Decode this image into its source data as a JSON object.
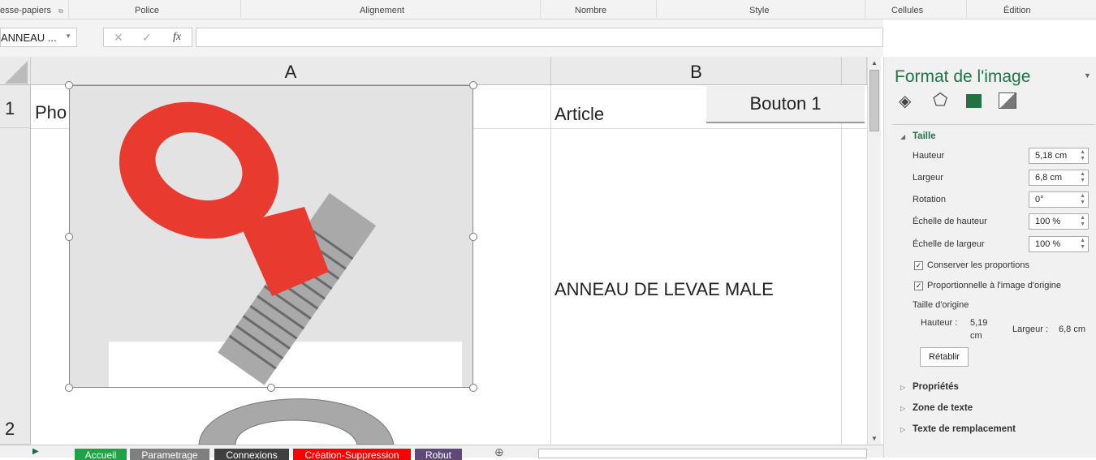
{
  "ribbon": {
    "groups": [
      "esse-papiers",
      "Police",
      "Alignement",
      "Nombre",
      "Style",
      "Cellules",
      "Édition"
    ]
  },
  "formula_bar": {
    "name_box": "ANNEAU ...",
    "cancel": "✕",
    "enter": "✓",
    "fx": "fx",
    "value": ""
  },
  "sheet": {
    "columns": [
      "A",
      "B"
    ],
    "rows": [
      "1",
      "2"
    ],
    "cells": {
      "A1": "Pho",
      "B1": "Article",
      "B2": "ANNEAU DE LEVAE MALE"
    },
    "button": "Bouton 1"
  },
  "sheet_tabs": [
    {
      "label": "Accueil",
      "color": "#1ea446"
    },
    {
      "label": "Parametrage",
      "color": "#7f7f7f"
    },
    {
      "label": "Connexions",
      "color": "#404040"
    },
    {
      "label": "Création-Suppression",
      "color": "#ff0000"
    },
    {
      "label": "Robut",
      "color": "#5f497a"
    }
  ],
  "panel": {
    "title": "Format de l'image",
    "icons": [
      "fill-line-icon",
      "effects-icon",
      "size-properties-icon",
      "picture-icon"
    ],
    "size_section": "Taille",
    "fields": [
      {
        "label": "Hauteur",
        "value": "5,18 cm"
      },
      {
        "label": "Largeur",
        "value": "6,8 cm"
      },
      {
        "label": "Rotation",
        "value": "0°"
      },
      {
        "label": "Échelle de hauteur",
        "value": "100 %"
      },
      {
        "label": "Échelle de largeur",
        "value": "100 %"
      }
    ],
    "checkboxes": [
      {
        "label": "Conserver les proportions",
        "checked": true
      },
      {
        "label": "Proportionnelle à l'image d'origine",
        "checked": true
      }
    ],
    "original_size": "Taille d'origine",
    "orig_h_label": "Hauteur :",
    "orig_h": "5,19",
    "orig_h_unit": "cm",
    "orig_w_label": "Largeur :",
    "orig_w": "6,8 cm",
    "reset": "Rétablir",
    "sections": [
      "Propriétés",
      "Zone de texte",
      "Texte de remplacement"
    ]
  }
}
